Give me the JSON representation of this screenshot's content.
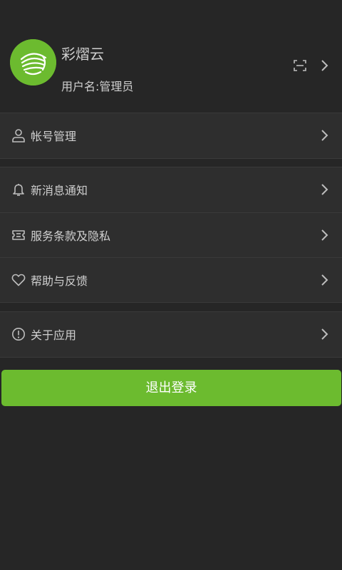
{
  "profile": {
    "app_name": "彩熠云",
    "username": "用户名:管理员",
    "avatar_icon": "app-logo",
    "scan_icon": "scan-icon",
    "chevron_icon": "chevron-right-icon"
  },
  "menu": {
    "account": [
      {
        "icon": "user-icon",
        "label": "帐号管理"
      }
    ],
    "settings": [
      {
        "icon": "bell-icon",
        "label": "新消息通知"
      },
      {
        "icon": "ticket-icon",
        "label": "服务条款及隐私"
      },
      {
        "icon": "heart-icon",
        "label": "帮助与反馈"
      }
    ],
    "about": [
      {
        "icon": "info-icon",
        "label": "关于应用"
      }
    ]
  },
  "logout": {
    "label": "退出登录"
  },
  "colors": {
    "background": "#262626",
    "row_background": "#2e2e2e",
    "accent": "#6cbb2f",
    "text": "#cfcfcf",
    "icon": "#bdbdbd"
  }
}
